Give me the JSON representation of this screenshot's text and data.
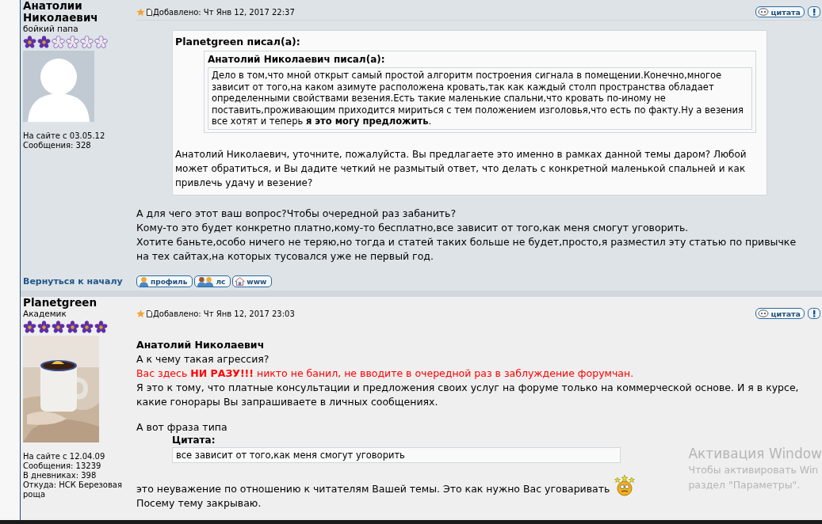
{
  "posts": [
    {
      "author": "Анатолии Николаевич",
      "rank": "бойкий папа",
      "stars": 2,
      "avatar": {
        "kind": "default"
      },
      "info": [
        "На сайте с 03.05.12",
        "Сообщения: 328"
      ],
      "date": "Добавлено: Чт Янв 12, 2017 22:37",
      "quote_button": "цитата",
      "body": [
        {
          "kind": "quote",
          "author": "Planetgreen писал(а):",
          "inner": {
            "author": "Анатолий Николаевич писал(а):",
            "text": "Дело в том,что мной открыт самый простой алгоритм построения сигнала в помещении.Конечно,многое зависит от того,на каком азимуте расположена кровать,так как каждый столп пространства обладает определенными свойствами везения.Есть такие маленькие спальни,что кровать по-иному не поставить,проживающим приходится мириться с тем положением изголовья,что есть по факту.Ну а везения все хотят и теперь **я это могу предложить**."
          },
          "text": "Анатолий Николаевич, уточните, пожалуйста. Вы предлагаете это именно в рамках данной темы даром? Любой может обратиться, и Вы дадите четкий не размытый ответ, что делать с конкретной маленькой спальней и как привлечь удачу и везение?"
        },
        {
          "kind": "lines",
          "lines": [
            {
              "text": "А для чего этот ваш вопрос?Чтобы очередной раз забанить?"
            },
            {
              "text": "Кому-то это будет конкретно платно,кому-то бесплатно,все зависит от того,как меня смогут уговорить."
            },
            {
              "text": "Хотите баньте,особо ничего не теряю,но тогда и статей таких больше не будет,просто,я разместил эту статью по привычке на тех сайтах,на которых тусовался уже не первый год."
            }
          ]
        }
      ],
      "footer": {
        "back": "Вернуться к началу",
        "buttons": [
          {
            "kind": "profile",
            "label": "профиль"
          },
          {
            "kind": "pm",
            "label": "лс"
          },
          {
            "kind": "www",
            "label": "www"
          }
        ]
      }
    },
    {
      "author": "Planetgreen",
      "rank": "Академик",
      "stars": 6,
      "info": [
        "На сайте с 12.04.09",
        "Сообщения: 13239",
        "В дневниках: 398",
        "Откуда: НСК Березовая роща"
      ],
      "date": "Добавлено: Чт Янв 12, 2017 23:03",
      "quote_button": "цитата",
      "body": [
        {
          "kind": "lines",
          "lines": [
            {
              "text": "Анатолий Николаевич",
              "kind": "bold"
            },
            {
              "text": "А к чему такая агрессия?"
            },
            {
              "text": "Вас здесь **НИ РАЗУ!!!** никто не банил, не вводите в очередной раз в заблуждение форумчан.",
              "kind": "alert"
            },
            {
              "text": "Я это к тому, что платные консультации и предложения своих услуг на форуме только на коммерческой основе. И я в курсе, какие гонорары Вы запрашиваете в личных сообщениях."
            }
          ]
        },
        {
          "kind": "lines",
          "lines": [
            {
              "text": "А вот фраза типа"
            }
          ]
        },
        {
          "kind": "cite",
          "label": "Цитата:",
          "text": "все зависит от того,как меня смогут уговорить"
        },
        {
          "kind": "lines",
          "lines": [
            {
              "text": "это неуважение по отношению к читателям Вашей темы. Это как нужно Вас уговаривать",
              "smiley": true
            },
            {
              "text": "Посему тему закрываю."
            }
          ]
        }
      ]
    }
  ],
  "os_notice": {
    "title": "Активация Window",
    "lines": [
      "Чтобы активировать Win",
      "раздел \"Параметры\"."
    ]
  }
}
